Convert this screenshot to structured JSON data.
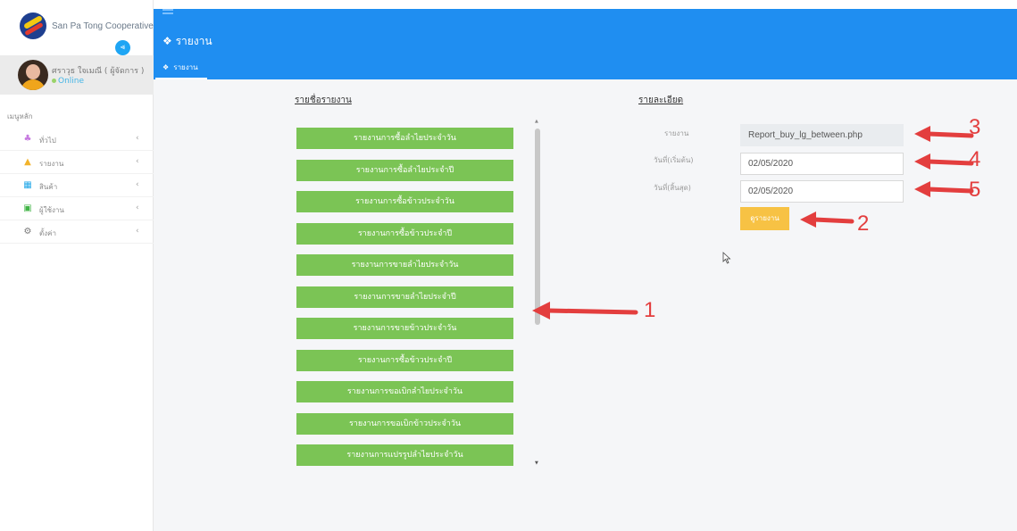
{
  "brand": {
    "name": "San Pa Tong Cooperative"
  },
  "user": {
    "name": "ศราวุธ ใจเมณี ( ผู้จัดการ )",
    "status": "Online"
  },
  "sidebar": {
    "menu_header": "เมนูหลัก",
    "items": [
      {
        "label": "ทั่วไป",
        "icon": "general-icon",
        "color": "#c77be0"
      },
      {
        "label": "รายงาน",
        "icon": "report-icon",
        "color": "#f2b32b"
      },
      {
        "label": "สินค้า",
        "icon": "product-icon",
        "color": "#22a7e8"
      },
      {
        "label": "ผู้ใช้งาน",
        "icon": "users-icon",
        "color": "#43b548"
      },
      {
        "label": "ตั้งค่า",
        "icon": "gear-icon",
        "color": "#777777"
      }
    ]
  },
  "header": {
    "title": "รายงาน",
    "tab_label": "รายงาน",
    "color": "#1f8ef1"
  },
  "report_list": {
    "title": "รายชื่อรายงาน",
    "items": [
      "รายงานการซื้อลำไยประจำวัน",
      "รายงานการซื้อลำไยประจำปี",
      "รายงานการซื้อข้าวประจำวัน",
      "รายงานการซื้อข้าวประจำปี",
      "รายงานการขายลำไยประจำวัน",
      "รายงานการขายลำไยประจำปี",
      "รายงานการขายข้าวประจำวัน",
      "รายงานการซื้อข้าวประจำปี",
      "รายงานการขอเบิกลำไยประจำวัน",
      "รายงานการขอเบิกข้าวประจำวัน",
      "รายงานการแปรรูปลำไยประจำวัน"
    ],
    "button_color": "#7bc455"
  },
  "details": {
    "title": "รายละเอียด",
    "report_label": "รายงาน",
    "report_value": "Report_buy_lg_between.php",
    "start_label": "วันที่(เริ่มต้น)",
    "start_value": "02/05/2020",
    "end_label": "วันที่(สิ้นสุด)",
    "end_value": "02/05/2020",
    "view_button": "ดูรายงาน"
  },
  "annotations": {
    "color": "#e33e3e",
    "numbers": [
      "1",
      "2",
      "3",
      "4",
      "5"
    ]
  }
}
